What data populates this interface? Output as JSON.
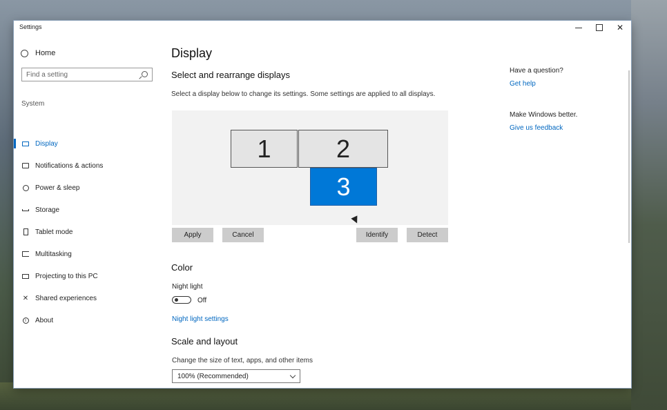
{
  "window": {
    "title": "Settings",
    "controls": {
      "minimize": "",
      "maximize": "",
      "close": "✕"
    }
  },
  "sidebar": {
    "home_label": "Home",
    "search_placeholder": "Find a setting",
    "section_label": "System",
    "items": [
      {
        "label": "Display",
        "icon": "monitor-icon",
        "active": true
      },
      {
        "label": "Notifications & actions",
        "icon": "notification-icon",
        "active": false
      },
      {
        "label": "Power & sleep",
        "icon": "power-icon",
        "active": false
      },
      {
        "label": "Storage",
        "icon": "storage-icon",
        "active": false
      },
      {
        "label": "Tablet mode",
        "icon": "tablet-icon",
        "active": false
      },
      {
        "label": "Multitasking",
        "icon": "multitasking-icon",
        "active": false
      },
      {
        "label": "Projecting to this PC",
        "icon": "projecting-icon",
        "active": false
      },
      {
        "label": "Shared experiences",
        "icon": "shared-experiences-icon",
        "active": false
      },
      {
        "label": "About",
        "icon": "about-icon",
        "active": false
      }
    ]
  },
  "main": {
    "title": "Display",
    "arrange_heading": "Select and rearrange displays",
    "arrange_desc": "Select a display below to change its settings. Some settings are applied to all displays.",
    "monitors": [
      {
        "number": "1",
        "selected": false
      },
      {
        "number": "2",
        "selected": false
      },
      {
        "number": "3",
        "selected": true
      }
    ],
    "buttons": {
      "apply": "Apply",
      "cancel": "Cancel",
      "identify": "Identify",
      "detect": "Detect"
    },
    "color_heading": "Color",
    "night_light_label": "Night light",
    "night_light_state": "Off",
    "night_light_settings_link": "Night light settings",
    "scale_heading": "Scale and layout",
    "scale_desc": "Change the size of text, apps, and other items",
    "scale_value": "100% (Recommended)"
  },
  "right_panel": {
    "question": "Have a question?",
    "help_link": "Get help",
    "better_text": "Make Windows better.",
    "feedback_link": "Give us feedback"
  },
  "colors": {
    "accent": "#0078d7",
    "link": "#0067c0"
  }
}
